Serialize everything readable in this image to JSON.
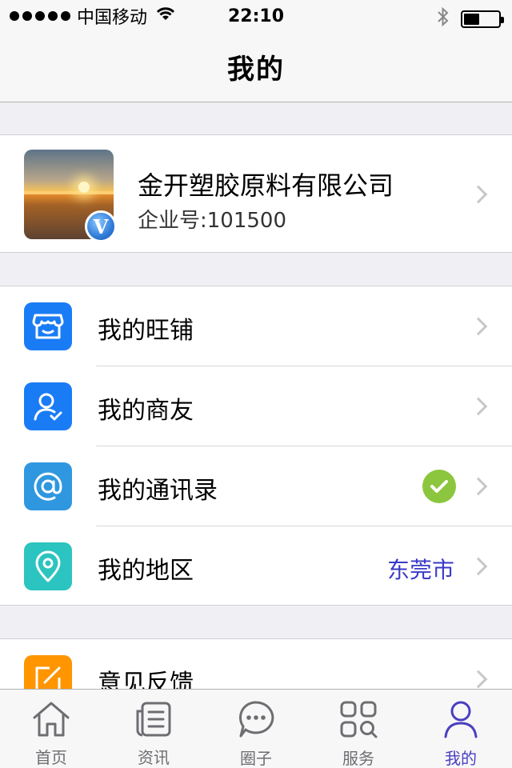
{
  "status_bar": {
    "carrier": "中国移动",
    "time": "22:10",
    "battery_level": 0.45
  },
  "nav": {
    "title": "我的"
  },
  "profile": {
    "company_name": "金开塑胶原料有限公司",
    "company_id": "企业号:101500",
    "verified_badge": "V"
  },
  "menu": {
    "items": [
      {
        "label": "我的旺铺",
        "icon": "store-icon",
        "color": "#1a7cf5"
      },
      {
        "label": "我的商友",
        "icon": "contact-check-icon",
        "color": "#1a7cf5"
      },
      {
        "label": "我的通讯录",
        "icon": "at-icon",
        "color": "#2f97e0"
      },
      {
        "label": "我的地区",
        "icon": "location-pin-icon",
        "color": "#2cc4c0",
        "value": "东莞市"
      }
    ],
    "feedback": {
      "label": "意见反馈",
      "icon": "edit-icon",
      "color": "#ff9500"
    }
  },
  "tabs": [
    {
      "label": "首页",
      "icon": "home-icon"
    },
    {
      "label": "资讯",
      "icon": "news-icon"
    },
    {
      "label": "圈子",
      "icon": "chat-bubble-icon"
    },
    {
      "label": "服务",
      "icon": "grid-search-icon"
    },
    {
      "label": "我的",
      "icon": "person-icon",
      "active": true
    }
  ],
  "colors": {
    "accent": "#4a3fc1",
    "region_text": "#3a3ac8",
    "check_green": "#8cc63e"
  }
}
